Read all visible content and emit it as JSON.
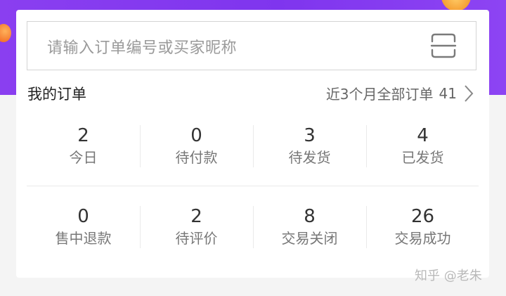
{
  "search": {
    "placeholder": "请输入订单编号或买家昵称"
  },
  "orders": {
    "title": "我的订单",
    "summary_label": "近3个月全部订单",
    "summary_count": "41"
  },
  "stats": [
    {
      "value": "2",
      "label": "今日"
    },
    {
      "value": "0",
      "label": "待付款"
    },
    {
      "value": "3",
      "label": "待发货"
    },
    {
      "value": "4",
      "label": "已发货"
    },
    {
      "value": "0",
      "label": "售中退款"
    },
    {
      "value": "2",
      "label": "待评价"
    },
    {
      "value": "8",
      "label": "交易关闭"
    },
    {
      "value": "26",
      "label": "交易成功"
    }
  ],
  "watermark": "知乎 @老朱",
  "icons": {
    "scan": "scan-icon",
    "chevron": "chevron-right-icon"
  },
  "colors": {
    "header_purple": "#8a3ff0",
    "card_bg": "#ffffff",
    "page_bg": "#f4f4f4"
  }
}
